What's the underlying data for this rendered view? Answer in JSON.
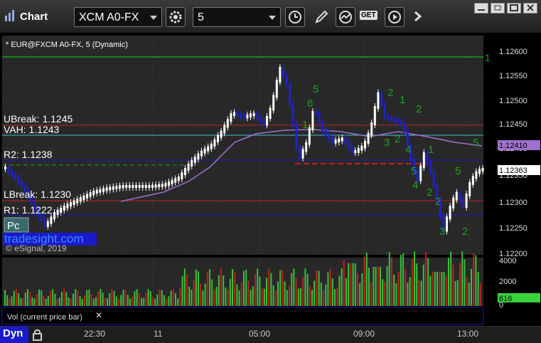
{
  "window": {
    "title": "Chart"
  },
  "toolbar": {
    "symbol": "XCM A0-FX",
    "interval": "5",
    "get_label": "GET"
  },
  "chart": {
    "header": "* EUR@FXCM A0-FX, 5 (Dynamic)",
    "watermark": "tradesight.com",
    "copyright": "© eSignal, 2019",
    "pc_label": "Pc",
    "price_axis": [
      "1.12600",
      "1.12550",
      "1.12500",
      "1.12450",
      "1.12400",
      "1.12350",
      "1.12300",
      "1.12250",
      "1.12200"
    ],
    "current_price": "1.12363",
    "vwap_price": "1.12410",
    "level_labels": {
      "ubreak": "UBreak: 1.1245",
      "vah": "VAH: 1.1243",
      "r2": "R2: 1.1238",
      "lbreak": "LBreak: 1.1230",
      "r1": "R1: 1.1222"
    },
    "line_marker": "1",
    "volume_axis": [
      "4000",
      "2000",
      "0"
    ],
    "volume_value": "616",
    "volume_label": "Vol (current price bar)",
    "time_axis": [
      "22:30",
      "11",
      "05:00",
      "09:00",
      "13:00"
    ],
    "colors": {
      "up": "#ffffff",
      "down": "#1e22c8",
      "vwap": "#a070d0",
      "resistance": "#c02020",
      "support": "#1a1ac0",
      "target": "#18a018",
      "count": "#1fa01f"
    }
  },
  "status": {
    "mode": "Dyn"
  }
}
